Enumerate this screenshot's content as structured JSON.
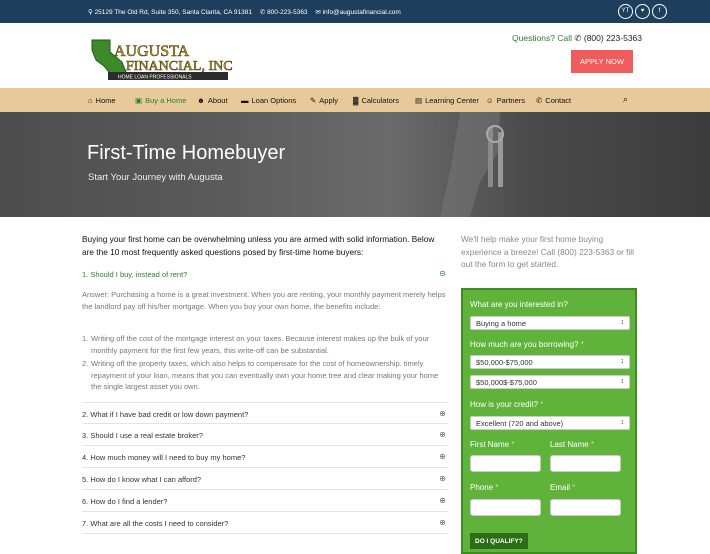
{
  "topbar": {
    "address": "⚲ 25129 The Old Rd, Suite 350, Santa Clarita, CA 91381",
    "phone": "✆ 800-223-5363",
    "email": "✉ info@augustafinancial.com",
    "social": [
      "YT",
      "♥",
      "f"
    ]
  },
  "header": {
    "logo_line1": "AUGUSTA",
    "logo_line2": "FINANCIAL, INC",
    "logo_tag": "HOME LOAN PROFESSIONALS",
    "questions": "Questions? Call",
    "phone": "✆ (800) 223-5363",
    "apply_label": "APPLY NOW"
  },
  "nav": {
    "items": [
      {
        "icon": "⌂",
        "label": "Home"
      },
      {
        "icon": "▣",
        "label": "Buy a Home"
      },
      {
        "icon": "☻",
        "label": "About"
      },
      {
        "icon": "▬",
        "label": "Loan Options"
      },
      {
        "icon": "✎",
        "label": "Apply"
      },
      {
        "icon": "▓",
        "label": "Calculators"
      },
      {
        "icon": "▤",
        "label": "Learning Center"
      },
      {
        "icon": "☺",
        "label": "Partners"
      },
      {
        "icon": "✆",
        "label": "Contact"
      }
    ],
    "search_icon": "⌕"
  },
  "hero": {
    "title": "First-Time Homebuyer",
    "subtitle": "Start Your Journey with Augusta"
  },
  "faq": {
    "intro": "Buying your first home can be overwhelming unless you are armed with solid information. Below are the 10 most frequently asked questions posed by first-time home buyers:",
    "open_question": "1. Should I buy, instead of rent?",
    "answer": "Answer: Purchasing a home is a great investment. When you are renting, your monthly payment merely helps the landlord pay off his/her mortgage. When you buy your own home, the benefits include:",
    "benefits": [
      {
        "n": "1.",
        "text": "Writing off the cost of the mortgage interest on your taxes. Because interest makes up the bulk of your monthly payment for the first few years, this write-off can be substantial."
      },
      {
        "n": "2.",
        "text": "Writing off the property taxes, which also helps to compensate for the cost of homeownership. timely repayment of your loan, means that you can eventually own your home tree and clear making your home the single largest asset you own."
      }
    ],
    "questions": [
      "2. What if I have bad credit or low down payment?",
      "3. Should I use a real estate broker?",
      "4. How much money will I need to buy my home?",
      "5. How do I know what I can afford?",
      "6. How do I find a lender?",
      "7. What are all the costs I need to consider?"
    ],
    "collapse_symbol": "⊝",
    "expand_symbol": "⊕"
  },
  "sidebar": {
    "intro": "We'll help make your first home buying experience a breeze! Call (800) 223-5363 or fill out the form to get started.",
    "form": {
      "interest_label": "What are you interested in?",
      "interest_value": "Buying a home",
      "borrow_label": "How much are you borrowing?",
      "borrow_value1": "$50,000-$75,000",
      "borrow_value2": "$50,000$-$75,000",
      "credit_label": "How is your credit?",
      "credit_value": "Excellent (720 and above)",
      "first_name_label": "First Name",
      "last_name_label": "Last Name",
      "phone_label": "Phone",
      "email_label": "Email",
      "required_mark": "*",
      "submit_label": "DO I QUALIFY?",
      "select_arrow": "↕"
    }
  }
}
